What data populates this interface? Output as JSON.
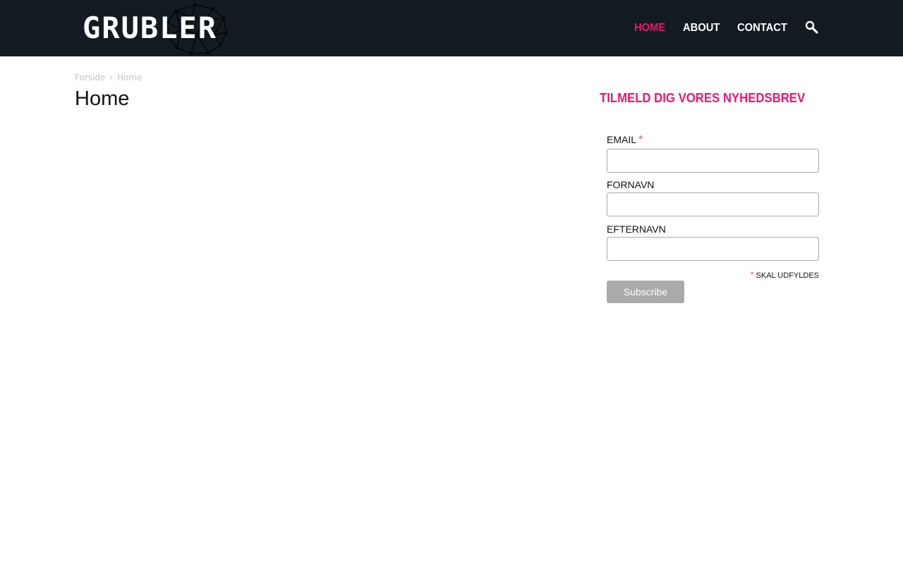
{
  "header": {
    "logo_text": "GRUBLER",
    "nav": [
      {
        "label": "HOME",
        "active": true
      },
      {
        "label": "ABOUT",
        "active": false
      },
      {
        "label": "CONTACT",
        "active": false
      }
    ],
    "search_icon": "search-icon",
    "background_color": "#121b21",
    "accent_color": "#f2136e"
  },
  "breadcrumb": {
    "items": [
      "Forside",
      "Home"
    ],
    "separator": "›"
  },
  "page": {
    "title": "Home"
  },
  "newsletter": {
    "title": "TILMELD DIG VORES NYHEDSBREV",
    "fields": [
      {
        "label": "EMAIL",
        "required": true,
        "value": "",
        "required_mark": "*"
      },
      {
        "label": "FORNAVN",
        "required": false,
        "value": ""
      },
      {
        "label": "EFTERNAVN",
        "required": false,
        "value": ""
      }
    ],
    "required_note_mark": "*",
    "required_note": "SKAL UDFYLDES",
    "submit_label": "Subscribe"
  }
}
